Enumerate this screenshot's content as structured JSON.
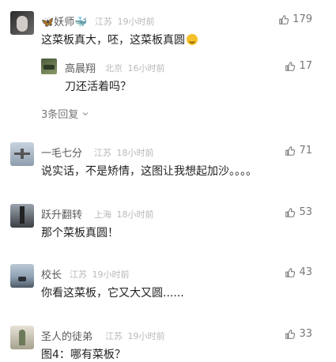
{
  "comments": [
    {
      "name": "妖师",
      "name_prefix": "🦋",
      "name_suffix": "🐳",
      "location": "江苏",
      "time": "19小时前",
      "text": "这菜板真大，呸，这菜板真圆",
      "likes": "179",
      "reply": {
        "name": "高晨翔",
        "location": "北京",
        "time": "16小时前",
        "text": "刀还活着吗？",
        "likes": "17"
      },
      "more_replies": "3条回复"
    },
    {
      "name": "一毛七分",
      "location": "江苏",
      "time": "18小时前",
      "text": "说实话，不是矫情，这图让我想起加沙。。。。",
      "likes": "71"
    },
    {
      "name": "跃升翻转",
      "location": "上海",
      "time": "18小时前",
      "text": "那个菜板真圆！",
      "likes": "53"
    },
    {
      "name": "校长",
      "location": "江苏",
      "time": "19小时前",
      "text": "你看这菜板，它又大又圆......",
      "likes": "43"
    },
    {
      "name": "圣人的徒弟",
      "location": "江苏",
      "time": "19小时前",
      "text": "图4：哪有菜板？",
      "likes": "33"
    }
  ],
  "icons": {
    "like": "thumbs-up-icon",
    "expand": "chevron-down-icon"
  }
}
